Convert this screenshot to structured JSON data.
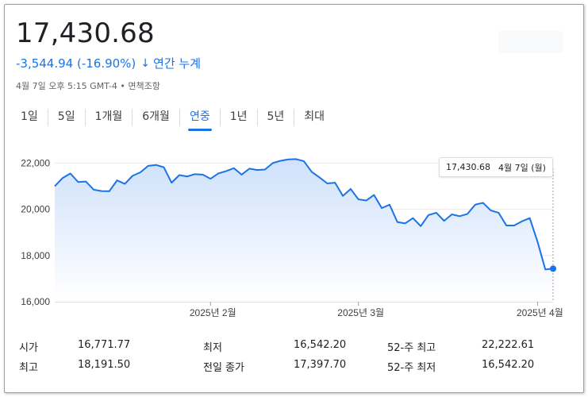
{
  "quote": {
    "price": "17,430.68",
    "change": "-3,544.94 (-16.90%)",
    "change_arrow": "↓",
    "period_label": "연간 누계",
    "timestamp": "4월 7일 오후 5:15 GMT-4 • 면책조항"
  },
  "tabs": [
    {
      "label": "1일",
      "active": false
    },
    {
      "label": "5일",
      "active": false
    },
    {
      "label": "1개월",
      "active": false
    },
    {
      "label": "6개월",
      "active": false
    },
    {
      "label": "연중",
      "active": true
    },
    {
      "label": "1년",
      "active": false
    },
    {
      "label": "5년",
      "active": false
    },
    {
      "label": "최대",
      "active": false
    }
  ],
  "tooltip": {
    "value": "17,430.68",
    "date": "4월 7일 (월)"
  },
  "colors": {
    "accent": "#1a73e8",
    "line": "#1a73e8",
    "fill_top": "#cfe1fb",
    "fill_bottom": "#ffffff"
  },
  "chart_data": {
    "type": "area",
    "ylim": [
      16000,
      22700
    ],
    "y_ticks": [
      16000,
      18000,
      20000,
      22000
    ],
    "y_tick_labels": [
      "16,000",
      "18,000",
      "20,000",
      "22,000"
    ],
    "x_tick_labels": [
      {
        "label": "2025년 2월",
        "index": 20
      },
      {
        "label": "2025년 3월",
        "index": 39
      },
      {
        "label": "2025년 4월",
        "index": 62
      }
    ],
    "values": [
      21000,
      21350,
      21550,
      21180,
      21200,
      20850,
      20790,
      20780,
      21250,
      21100,
      21450,
      21600,
      21880,
      21920,
      21820,
      21150,
      21480,
      21420,
      21520,
      21500,
      21320,
      21550,
      21650,
      21780,
      21500,
      21760,
      21700,
      21720,
      22000,
      22100,
      22160,
      22170,
      22080,
      21620,
      21380,
      21120,
      21150,
      20580,
      20880,
      20430,
      20380,
      20620,
      20050,
      20200,
      19450,
      19390,
      19620,
      19270,
      19750,
      19850,
      19500,
      19780,
      19700,
      19800,
      20200,
      20280,
      19950,
      19850,
      19300,
      19300,
      19480,
      19620,
      18600,
      17397.7,
      17430.68
    ],
    "last_value": 17430.68
  },
  "stats": {
    "rows": [
      [
        {
          "label": "시가",
          "value": "16,771.77"
        },
        {
          "label": "최저",
          "value": "16,542.20"
        },
        {
          "label": "52-주 최고",
          "value": "22,222.61"
        }
      ],
      [
        {
          "label": "최고",
          "value": "18,191.50"
        },
        {
          "label": "전일 종가",
          "value": "17,397.70"
        },
        {
          "label": "52-주 최저",
          "value": "16,542.20"
        }
      ]
    ]
  }
}
